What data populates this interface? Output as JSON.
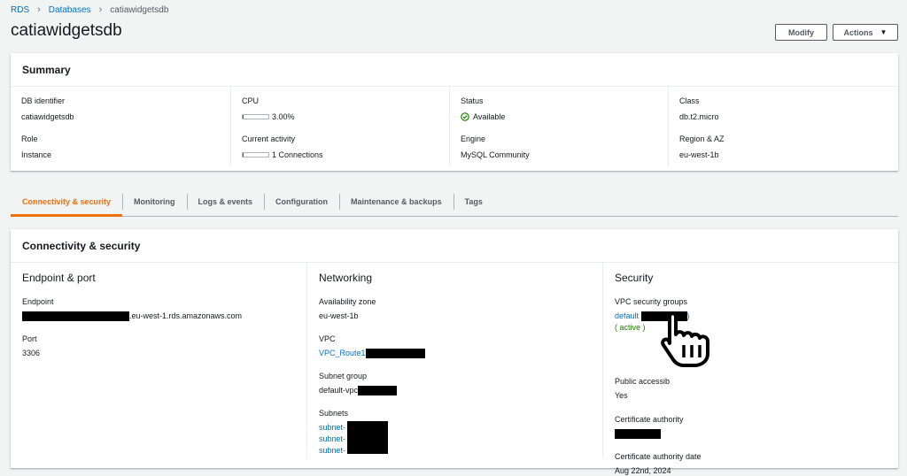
{
  "breadcrumb": {
    "items": [
      "RDS",
      "Databases"
    ],
    "current": "catiawidgetsdb"
  },
  "page": {
    "title": "catiawidgetsdb"
  },
  "toolbar": {
    "modify_label": "Modify",
    "actions_label": "Actions"
  },
  "summary": {
    "title": "Summary",
    "db_identifier": {
      "label": "DB identifier",
      "value": "catiawidgetsdb"
    },
    "role": {
      "label": "Role",
      "value": "Instance"
    },
    "cpu": {
      "label": "CPU",
      "value": "3.00%",
      "fraction": 0.03
    },
    "current_activity": {
      "label": "Current activity",
      "value": "1 Connections",
      "fraction": 0.03
    },
    "status": {
      "label": "Status",
      "value": "Available"
    },
    "engine": {
      "label": "Engine",
      "value": "MySQL Community"
    },
    "class": {
      "label": "Class",
      "value": "db.t2.micro"
    },
    "region_az": {
      "label": "Region & AZ",
      "value": "eu-west-1b"
    }
  },
  "tabs": [
    {
      "label": "Connectivity & security",
      "active": true
    },
    {
      "label": "Monitoring"
    },
    {
      "label": "Logs & events"
    },
    {
      "label": "Configuration"
    },
    {
      "label": "Maintenance & backups"
    },
    {
      "label": "Tags"
    }
  ],
  "connectivity": {
    "title": "Connectivity & security",
    "endpoint_port": {
      "title": "Endpoint & port",
      "endpoint_label": "Endpoint",
      "endpoint_suffix": ".eu-west-1.rds.amazonaws.com",
      "port_label": "Port",
      "port_value": "3306"
    },
    "networking": {
      "title": "Networking",
      "az_label": "Availability zone",
      "az_value": "eu-west-1b",
      "vpc_label": "VPC",
      "vpc_value": "VPC_Route1",
      "subnet_group_label": "Subnet group",
      "subnet_group_value": "default-vpc",
      "subnets_label": "Subnets",
      "subnets": [
        "subnet-",
        "subnet-",
        "subnet-"
      ]
    },
    "security": {
      "title": "Security",
      "vpc_sg_label": "VPC security groups",
      "vpc_sg_value": "default",
      "vpc_sg_close": ")",
      "vpc_sg_status": "( active )",
      "public_access_label": "Public accessib",
      "public_access_value": "Yes",
      "cert_authority_label": "Certificate authority",
      "cert_date_label": "Certificate authority date",
      "cert_date_value": "Aug 22nd, 2024"
    }
  },
  "colors": {
    "accent_tab": "#ec7211",
    "link": "#0073bb",
    "success": "#1d8102"
  }
}
